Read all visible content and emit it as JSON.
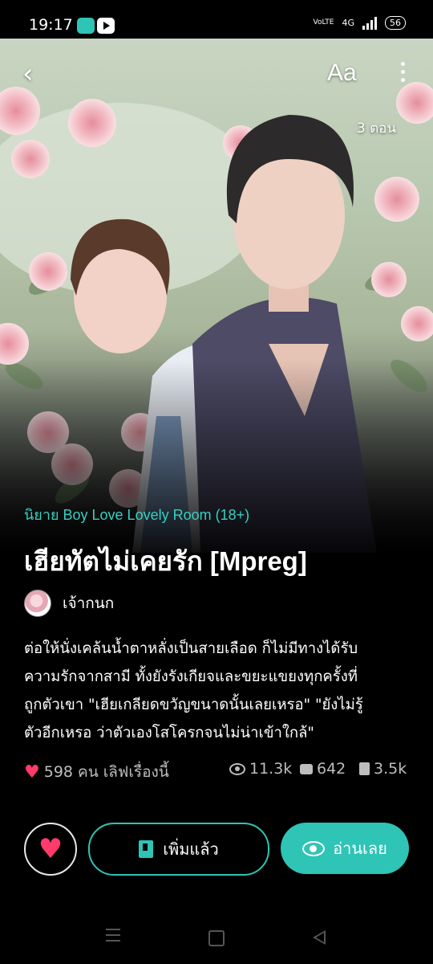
{
  "status_bar": {
    "time": "19:17",
    "network": "4G",
    "volte": "VoLTE",
    "battery": "56"
  },
  "header": {
    "font_button": "Aa",
    "episodes": "3 ตอน"
  },
  "novel": {
    "category": "นิยาย Boy Love Lovely Room  (18+)",
    "title": "เฮียทัตไม่เคยรัก [Mpreg]",
    "author": "เจ้ากนก",
    "synopsis_lines": [
      "ต่อให้นั่งเคล้นน้ำตาหลั่งเป็นสายเลือด ก็ไม่มีทางได้รับ",
      "ความรักจากสามี ทั้งยังรังเกียจและขยะแขยงทุกครั้งที่",
      "ถูกตัวเขา \"เฮียเกลียดขวัญขนาดนั้นเลยเหรอ\" \"ยังไม่รู้",
      "ตัวอีกเหรอ ว่าตัวเองโสโครกจนไม่น่าเข้าใกล้\""
    ]
  },
  "stats": {
    "likes": "598 คน เลิฟเรื่องนี้",
    "views": "11.3k",
    "comments": "642",
    "chapters": "3.5k"
  },
  "actions": {
    "added_label": "เพิ่มแล้ว",
    "read_label": "อ่านเลย"
  },
  "colors": {
    "accent": "#2ec4b6",
    "like": "#ff3b6b",
    "background": "#000000"
  }
}
